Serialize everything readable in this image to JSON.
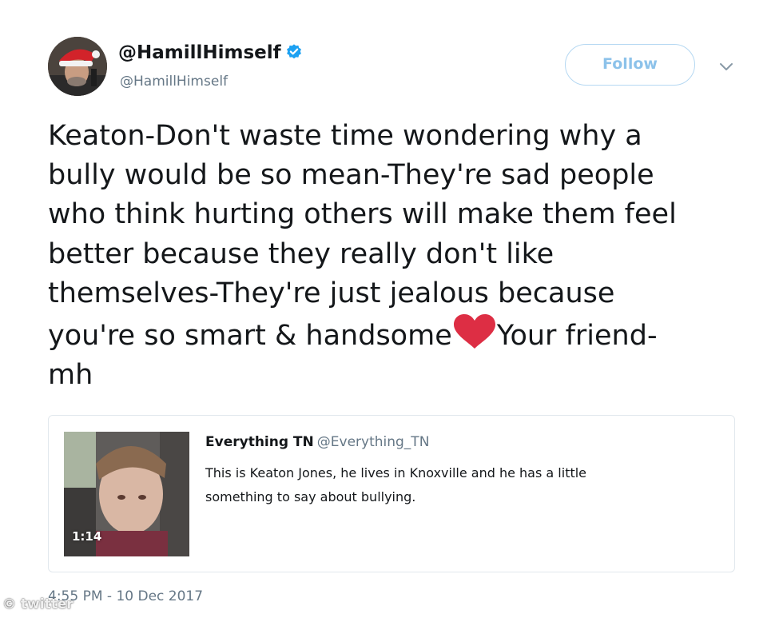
{
  "tweet": {
    "display_name": "@HamillHimself",
    "handle": "@HamillHimself",
    "verified": true,
    "follow_label": "Follow",
    "text_lines": [
      "Keaton-Don't waste time wondering why a",
      "bully would be so mean-They're sad people",
      "who think hurting others will make them feel",
      "better because they really don't like",
      "themselves-They're just jealous because",
      "you're so smart & handsome",
      "Your friend-",
      "mh"
    ],
    "emoji": "heart",
    "timestamp": "4:55 PM - 10 Dec 2017"
  },
  "quoted_tweet": {
    "name": "Everything TN",
    "handle": "@Everything_TN",
    "text_lines": [
      "This is Keaton Jones, he lives in Knoxville and he has a little",
      "something to say about bullying."
    ],
    "video_duration": "1:14"
  },
  "watermark": "© twitter",
  "colors": {
    "verified_blue": "#1da1f2",
    "follow_text": "#8cc2ea",
    "follow_border": "#b5d8f2",
    "heart_red": "#dd2e44",
    "secondary_text": "#657786",
    "card_border": "#e1e8ed"
  }
}
